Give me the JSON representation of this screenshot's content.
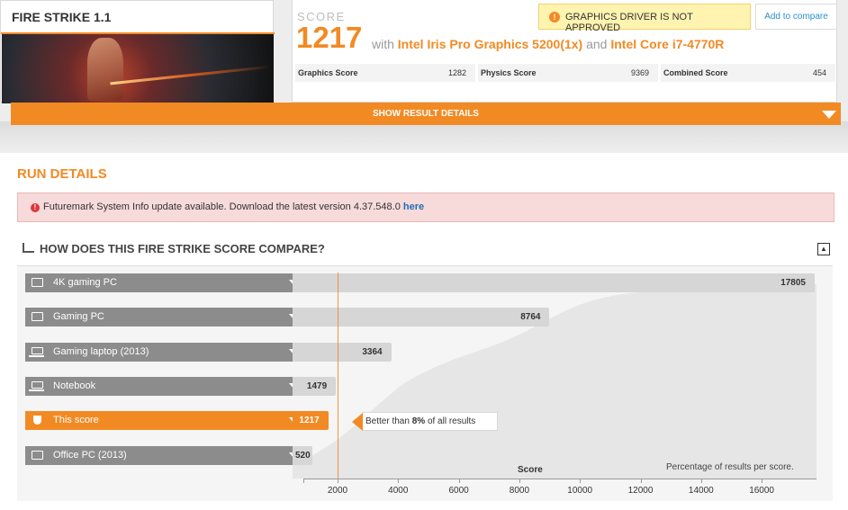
{
  "test": {
    "title": "FIRE STRIKE 1.1"
  },
  "score": {
    "label": "SCORE",
    "value": "1217",
    "with_word": "with",
    "gpu": "Intel Iris Pro Graphics 5200(1x)",
    "and_word": "and",
    "cpu": "Intel Core i7-4770R",
    "warning": "GRAPHICS DRIVER IS NOT APPROVED",
    "compare_button": "Add to compare",
    "subscores": [
      {
        "label": "Graphics Score",
        "value": "1282"
      },
      {
        "label": "Physics Score",
        "value": "9369"
      },
      {
        "label": "Combined Score",
        "value": "454"
      }
    ]
  },
  "details_bar": {
    "label": "SHOW RESULT DETAILS"
  },
  "run_details": {
    "title": "RUN DETAILS",
    "notice_text": "Futuremark System Info update available. Download the latest version 4.37.548.0",
    "notice_link": "here"
  },
  "compare": {
    "heading": "HOW DOES THIS FIRE STRIKE SCORE COMPARE?",
    "rows": [
      {
        "label": "4K gaming PC",
        "score": "17805",
        "icon": "monitor-icon"
      },
      {
        "label": "Gaming PC",
        "score": "8764",
        "icon": "monitor-icon"
      },
      {
        "label": "Gaming laptop (2013)",
        "score": "3364",
        "icon": "laptop-icon"
      },
      {
        "label": "Notebook",
        "score": "1479",
        "icon": "laptop-icon"
      },
      {
        "label": "This score",
        "score": "1217",
        "icon": "trophy-icon"
      },
      {
        "label": "Office PC (2013)",
        "score": "520",
        "icon": "monitor-icon"
      }
    ],
    "callout_pre": "Better than",
    "callout_pct": "8%",
    "callout_post": "of all results",
    "axis_title": "Score",
    "axis_note": "Percentage of results per score.",
    "ticks": [
      "2000",
      "4000",
      "6000",
      "8000",
      "10000",
      "12000",
      "14000",
      "16000"
    ]
  },
  "chart_data": {
    "type": "bar",
    "categories": [
      "4K gaming PC",
      "Gaming PC",
      "Gaming laptop (2013)",
      "Notebook",
      "This score",
      "Office PC (2013)"
    ],
    "values": [
      17805,
      8764,
      3364,
      1479,
      1217,
      520
    ],
    "xlabel": "Score",
    "xlim": [
      0,
      17805
    ],
    "xticks": [
      2000,
      4000,
      6000,
      8000,
      10000,
      12000,
      14000,
      16000
    ],
    "highlight": "This score",
    "colors": {
      "bar": "#d6d6d6",
      "highlight": "#f28a24",
      "label": "#8c8c8c"
    }
  }
}
